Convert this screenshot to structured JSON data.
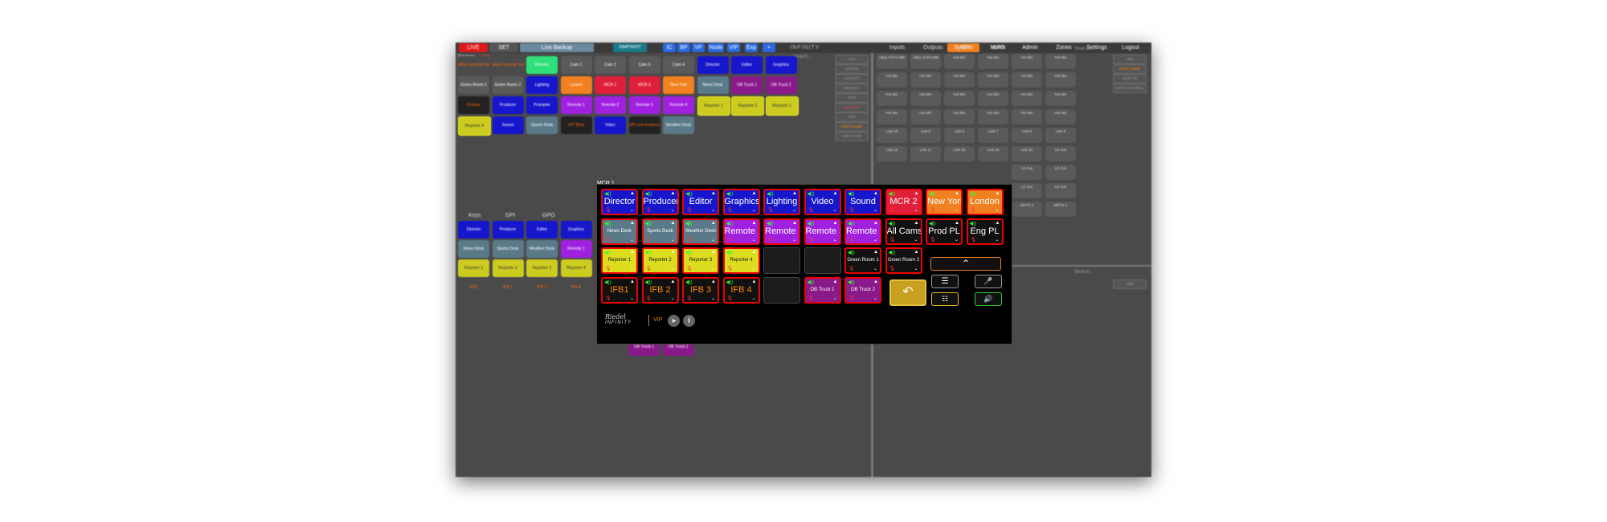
{
  "topbar": {
    "live": "LIVE",
    "set": "SET",
    "backup": "Live Backup",
    "snapshot": "SNAPSHOT",
    "logo": "INFINITY",
    "filters": [
      "IC",
      "BP",
      "VP",
      "Node",
      "VIP",
      "Exp",
      "+"
    ],
    "search_placeholder": "Search...",
    "nav": [
      "System",
      "Matrix",
      "Admin",
      "Zones",
      "Settings",
      "Logout"
    ]
  },
  "devices": {
    "title": "Devices",
    "status": "- LIVE",
    "rows": [
      [
        {
          "l": "Altus Console Mains",
          "c": "#4a4a4a",
          "t": "#f60"
        },
        {
          "l": "Altus Console Surface",
          "c": "#4a4a4a",
          "t": "#f60"
        },
        {
          "l": "Director",
          "c": "#2fe07a"
        },
        {
          "l": "Cam 1",
          "c": "#5a5a5a"
        },
        {
          "l": "Cam 2",
          "c": "#5a5a5a"
        },
        {
          "l": "Cam 3",
          "c": "#5a5a5a"
        },
        {
          "l": "Cam 4",
          "c": "#5a5a5a"
        },
        {
          "l": "Director",
          "c": "#1616cc"
        },
        {
          "l": "Editor",
          "c": "#1616cc"
        },
        {
          "l": "Graphics",
          "c": "#1616cc"
        }
      ],
      [
        {
          "l": "Green Room 1",
          "c": "#5a5a5a"
        },
        {
          "l": "Green Room 2",
          "c": "#5a5a5a"
        },
        {
          "l": "Lighting",
          "c": "#1616cc"
        },
        {
          "l": "London",
          "c": "#f08020"
        },
        {
          "l": "MCR 1",
          "c": "#e0203a"
        },
        {
          "l": "MCR 2",
          "c": "#e0203a"
        },
        {
          "l": "New York",
          "c": "#f08020"
        },
        {
          "l": "News Desk",
          "c": "#5a7a8a"
        },
        {
          "l": "OB Truck 1",
          "c": "#8a1a8a"
        },
        {
          "l": "OB Truck 2",
          "c": "#8a1a8a"
        }
      ],
      [
        {
          "l": "Portpac",
          "c": "#222",
          "t": "#f60"
        },
        {
          "l": "Producer",
          "c": "#1616cc"
        },
        {
          "l": "Prompter",
          "c": "#1616cc"
        },
        {
          "l": "Remote 1",
          "c": "#a020e0"
        },
        {
          "l": "Remote 2",
          "c": "#a020e0"
        },
        {
          "l": "Remote 3",
          "c": "#a020e0"
        },
        {
          "l": "Remote 4",
          "c": "#a020e0"
        },
        {
          "l": "Reporter 1",
          "c": "#cccc20",
          "t": "#333"
        },
        {
          "l": "Reporter 2",
          "c": "#cccc20",
          "t": "#333"
        },
        {
          "l": "Reporter 3",
          "c": "#cccc20",
          "t": "#333"
        }
      ],
      [
        {
          "l": "Reporter 4",
          "c": "#cccc20",
          "t": "#333"
        },
        {
          "l": "Sound",
          "c": "#1616cc"
        },
        {
          "l": "Sports Desk",
          "c": "#5a7a8a"
        },
        {
          "l": "V37 Beta",
          "c": "#222",
          "t": "#f60"
        },
        {
          "l": "Video",
          "c": "#1616cc"
        },
        {
          "l": "VIP Live Instance",
          "c": "#222",
          "t": "#f60"
        },
        {
          "l": "Weather Desk",
          "c": "#5a7a8a"
        }
      ]
    ],
    "side": [
      "ADD",
      "ASSIGN",
      "LOGOUT",
      "REBOOT",
      "INFO",
      "DELETE",
      "ADD",
      "SORT NAME",
      "SORT TYPE"
    ]
  },
  "keys_section": {
    "tabs": [
      "Keys",
      "GPI",
      "GPO"
    ],
    "rows": [
      [
        {
          "l": "Director",
          "c": "#1616cc"
        },
        {
          "l": "Producer",
          "c": "#1616cc"
        },
        {
          "l": "Editor",
          "c": "#1616cc"
        },
        {
          "l": "Graphics",
          "c": "#1616cc"
        }
      ],
      [
        {
          "l": "News Desk",
          "c": "#5a7a8a"
        },
        {
          "l": "Sports Desk",
          "c": "#5a7a8a"
        },
        {
          "l": "Weather Desk",
          "c": "#5a7a8a"
        },
        {
          "l": "Remote 1",
          "c": "#a020e0"
        }
      ],
      [
        {
          "l": "Reporter 1",
          "c": "#cccc20",
          "t": "#333"
        },
        {
          "l": "Reporter 2",
          "c": "#cccc20",
          "t": "#333"
        },
        {
          "l": "Reporter 3",
          "c": "#cccc20",
          "t": "#333"
        },
        {
          "l": "Reporter 4",
          "c": "#cccc20",
          "t": "#333"
        }
      ],
      [
        {
          "l": "IFB1",
          "c": "#4a4a4a",
          "t": "#f60"
        },
        {
          "l": "IFB 2",
          "c": "#4a4a4a",
          "t": "#f60"
        },
        {
          "l": "IFB 3",
          "c": "#4a4a4a",
          "t": "#f60"
        },
        {
          "l": "IFB 4",
          "c": "#4a4a4a",
          "t": "#f60"
        }
      ]
    ],
    "extra": [
      {
        "l": "OB Truck 1",
        "c": "#8a1a8a"
      },
      {
        "l": "OB Truck 2",
        "c": "#8a1a8a"
      }
    ]
  },
  "ports": {
    "tabs": [
      "Inputs",
      "Outputs",
      "GPI",
      "GPO"
    ],
    "search_placeholder": "Search...",
    "cells": [
      [
        "Altus VCP1 MM",
        "Altus VCP2 MM",
        "Hot Mic",
        "Hot Mic",
        "Hot Mic",
        "Hot Mic"
      ],
      [
        "Hot Mic",
        "Hot Mic",
        "Hot Mic",
        "Hot Mic",
        "Hot Mic",
        "Hot Mic"
      ],
      [
        "Hot Mic",
        "Hot Mic",
        "Hot Mic",
        "Hot Mic",
        "Hot Mic",
        "Hot Mic"
      ],
      [
        "Hot Mic",
        "Hot Mic",
        "Hot Mic",
        "Hot Mic",
        "Hot Mic",
        "Hot Mic"
      ],
      [
        "Link 10",
        "Link 5",
        "Link 6",
        "Link 7",
        "Link 8",
        "Link 9"
      ],
      [
        "Link 16",
        "Link 17",
        "Link 18",
        "Link 19",
        "Link 20",
        "LS Out"
      ],
      [
        "",
        "",
        "",
        "",
        "LS Out",
        "LS Out"
      ],
      [
        "",
        "",
        "",
        "",
        "LS Out",
        "LS Out"
      ],
      [
        "",
        "",
        "",
        "",
        "MPTS 1",
        "MPTS 2"
      ]
    ],
    "side": [
      "ADD",
      "SORT NAME",
      "SORT ID",
      "SORT CHANNEL"
    ],
    "lower_search": "Search...",
    "lower_btn": "ADD"
  },
  "panel": {
    "title": "MCR 1",
    "rows": [
      [
        {
          "l": "Director",
          "c": "#1616cc"
        },
        {
          "l": "Producer",
          "c": "#1616cc"
        },
        {
          "l": "Editor",
          "c": "#1616cc"
        },
        {
          "l": "Graphics",
          "c": "#1616cc"
        },
        {
          "l": "Lighting",
          "c": "#1616cc"
        },
        {
          "l": "Video",
          "c": "#1616cc"
        },
        {
          "l": "Sound",
          "c": "#1616cc"
        },
        {
          "l": "MCR 2",
          "c": "#e0203a"
        },
        {
          "l": "New York",
          "c": "#f08020"
        },
        {
          "l": "London",
          "c": "#f08020"
        }
      ],
      [
        {
          "l": "News Desk",
          "c": "#5a7a8a",
          "s": 1
        },
        {
          "l": "Sports Desk",
          "c": "#5a7a8a",
          "s": 1
        },
        {
          "l": "Weather Desk",
          "c": "#5a7a8a",
          "s": 1
        },
        {
          "l": "Remote 1",
          "c": "#a020e0"
        },
        {
          "l": "Remote 2",
          "c": "#a020e0"
        },
        {
          "l": "Remote 3",
          "c": "#a020e0"
        },
        {
          "l": "Remote 4",
          "c": "#a020e0"
        },
        {
          "l": "All Cams",
          "c": "#111"
        },
        {
          "l": "Prod PL",
          "c": "#111"
        },
        {
          "l": "Eng PL",
          "c": "#111"
        }
      ],
      [
        {
          "l": "Reporter 1",
          "c": "#dddd20",
          "s": 1,
          "t": "#111"
        },
        {
          "l": "Reporter 2",
          "c": "#dddd20",
          "s": 1,
          "t": "#111"
        },
        {
          "l": "Reporter 3",
          "c": "#dddd20",
          "s": 1,
          "t": "#111"
        },
        {
          "l": "Reporter 4",
          "c": "#dddd20",
          "s": 1,
          "t": "#111"
        },
        null,
        null,
        {
          "l": "Green Room 1",
          "c": "#111",
          "s": 1
        },
        {
          "l": "Green Room 2",
          "c": "#111",
          "s": 1
        }
      ],
      [
        {
          "l": "IFB1",
          "c": "#111",
          "t": "#f80"
        },
        {
          "l": "IFB 2",
          "c": "#111",
          "t": "#f80"
        },
        {
          "l": "IFB 3",
          "c": "#111",
          "t": "#f80"
        },
        {
          "l": "IFB 4",
          "c": "#111",
          "t": "#f80"
        },
        null,
        {
          "l": "OB Truck 1",
          "c": "#8a1a8a",
          "s": 1
        },
        {
          "l": "OB Truck 2",
          "c": "#8a1a8a",
          "s": 1
        }
      ]
    ],
    "vip": "VIP",
    "brand": "INFINITY"
  },
  "colors": {
    "live": "#e01818",
    "accent": "#f08020",
    "chrome": "#3a3a3a"
  }
}
